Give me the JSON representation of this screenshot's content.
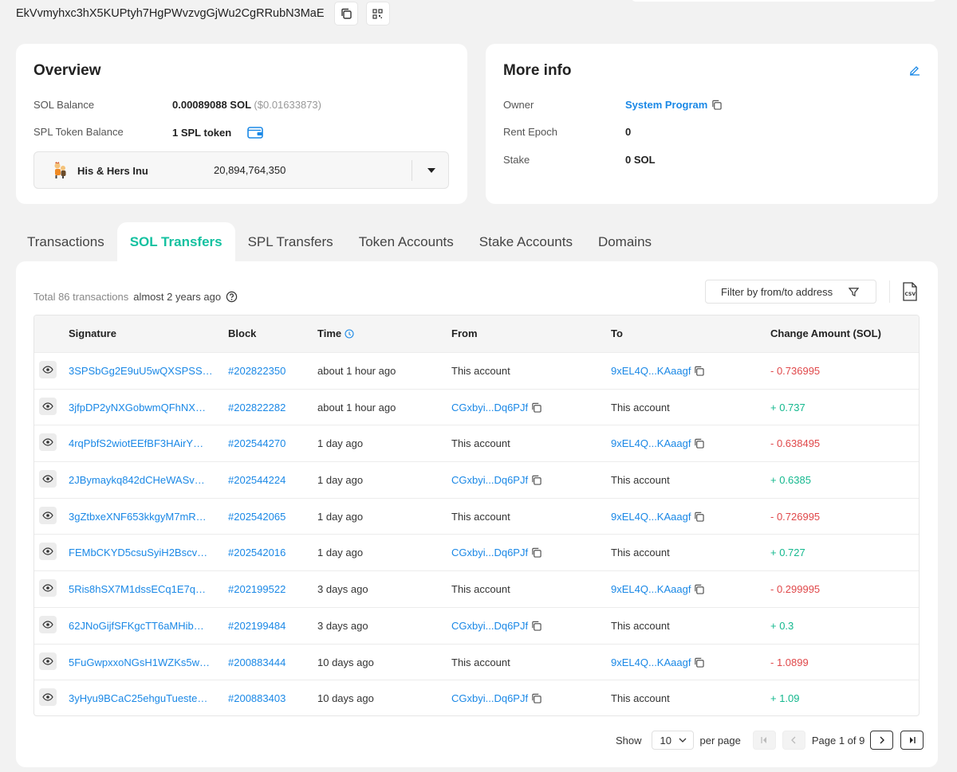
{
  "address": {
    "value": "EkVvmyhxc3hX5KUPtyh7HgPWvzvgGjWu2CgRRubN3MaE",
    "copy_icon": "copy-icon",
    "qr_icon": "qr-code-icon"
  },
  "overview": {
    "title": "Overview",
    "sol_balance_label": "SOL Balance",
    "sol_balance_value": "0.00089088 SOL",
    "sol_balance_usd": "($0.01633873)",
    "spl_label": "SPL Token Balance",
    "spl_value": "1 SPL token",
    "token": {
      "name": "His & Hers Inu",
      "amount": "20,894,764,350"
    }
  },
  "more_info": {
    "title": "More info",
    "owner_label": "Owner",
    "owner_value": "System Program",
    "rent_label": "Rent Epoch",
    "rent_value": "0",
    "stake_label": "Stake",
    "stake_value": "0 SOL"
  },
  "tabs": [
    {
      "label": "Transactions",
      "active": false
    },
    {
      "label": "SOL Transfers",
      "active": true
    },
    {
      "label": "SPL Transfers",
      "active": false
    },
    {
      "label": "Token Accounts",
      "active": false
    },
    {
      "label": "Stake Accounts",
      "active": false
    },
    {
      "label": "Domains",
      "active": false
    }
  ],
  "list": {
    "total": "Total 86 transactions",
    "ago": "almost 2 years ago",
    "filter_placeholder": "Filter by from/to address",
    "columns": {
      "signature": "Signature",
      "block": "Block",
      "time": "Time",
      "from": "From",
      "to": "To",
      "change": "Change Amount (SOL)"
    },
    "rows": [
      {
        "signature": "3SPSbGg2E9uU5wQXSPSS…",
        "block": "#202822350",
        "time": "about 1 hour ago",
        "from": "This account",
        "to": "9xEL4Q...KAaagf",
        "change": "- 0.736995"
      },
      {
        "signature": "3jfpDP2yNXGobwmQFhNX…",
        "block": "#202822282",
        "time": "about 1 hour ago",
        "from": "CGxbyi...Dq6PJf",
        "to": "This account",
        "change": "+ 0.737"
      },
      {
        "signature": "4rqPbfS2wiotEEfBF3HAirY…",
        "block": "#202544270",
        "time": "1 day ago",
        "from": "This account",
        "to": "9xEL4Q...KAaagf",
        "change": "- 0.638495"
      },
      {
        "signature": "2JBymaykq842dCHeWASv…",
        "block": "#202544224",
        "time": "1 day ago",
        "from": "CGxbyi...Dq6PJf",
        "to": "This account",
        "change": "+ 0.6385"
      },
      {
        "signature": "3gZtbxeXNF653kkgyM7mR…",
        "block": "#202542065",
        "time": "1 day ago",
        "from": "This account",
        "to": "9xEL4Q...KAaagf",
        "change": "- 0.726995"
      },
      {
        "signature": "FEMbCKYD5csuSyiH2Bscv…",
        "block": "#202542016",
        "time": "1 day ago",
        "from": "CGxbyi...Dq6PJf",
        "to": "This account",
        "change": "+ 0.727"
      },
      {
        "signature": "5Ris8hSX7M1dssECq1E7q…",
        "block": "#202199522",
        "time": "3 days ago",
        "from": "This account",
        "to": "9xEL4Q...KAaagf",
        "change": "- 0.299995"
      },
      {
        "signature": "62JNoGijfSFKgcTT6aMHib…",
        "block": "#202199484",
        "time": "3 days ago",
        "from": "CGxbyi...Dq6PJf",
        "to": "This account",
        "change": "+ 0.3"
      },
      {
        "signature": "5FuGwpxxoNGsH1WZKs5w…",
        "block": "#200883444",
        "time": "10 days ago",
        "from": "This account",
        "to": "9xEL4Q...KAaagf",
        "change": "- 1.0899"
      },
      {
        "signature": "3yHyu9BCaC25ehguTueste…",
        "block": "#200883403",
        "time": "10 days ago",
        "from": "CGxbyi...Dq6PJf",
        "to": "This account",
        "change": "+ 1.09"
      }
    ]
  },
  "pagination": {
    "show_label": "Show",
    "per_page_value": "10",
    "per_page_label": "per page",
    "page_text": "Page 1 of 9"
  },
  "colors": {
    "accent": "#14c1a0",
    "link": "#1a88e6",
    "negative": "#e0484a",
    "positive": "#14b88e"
  }
}
